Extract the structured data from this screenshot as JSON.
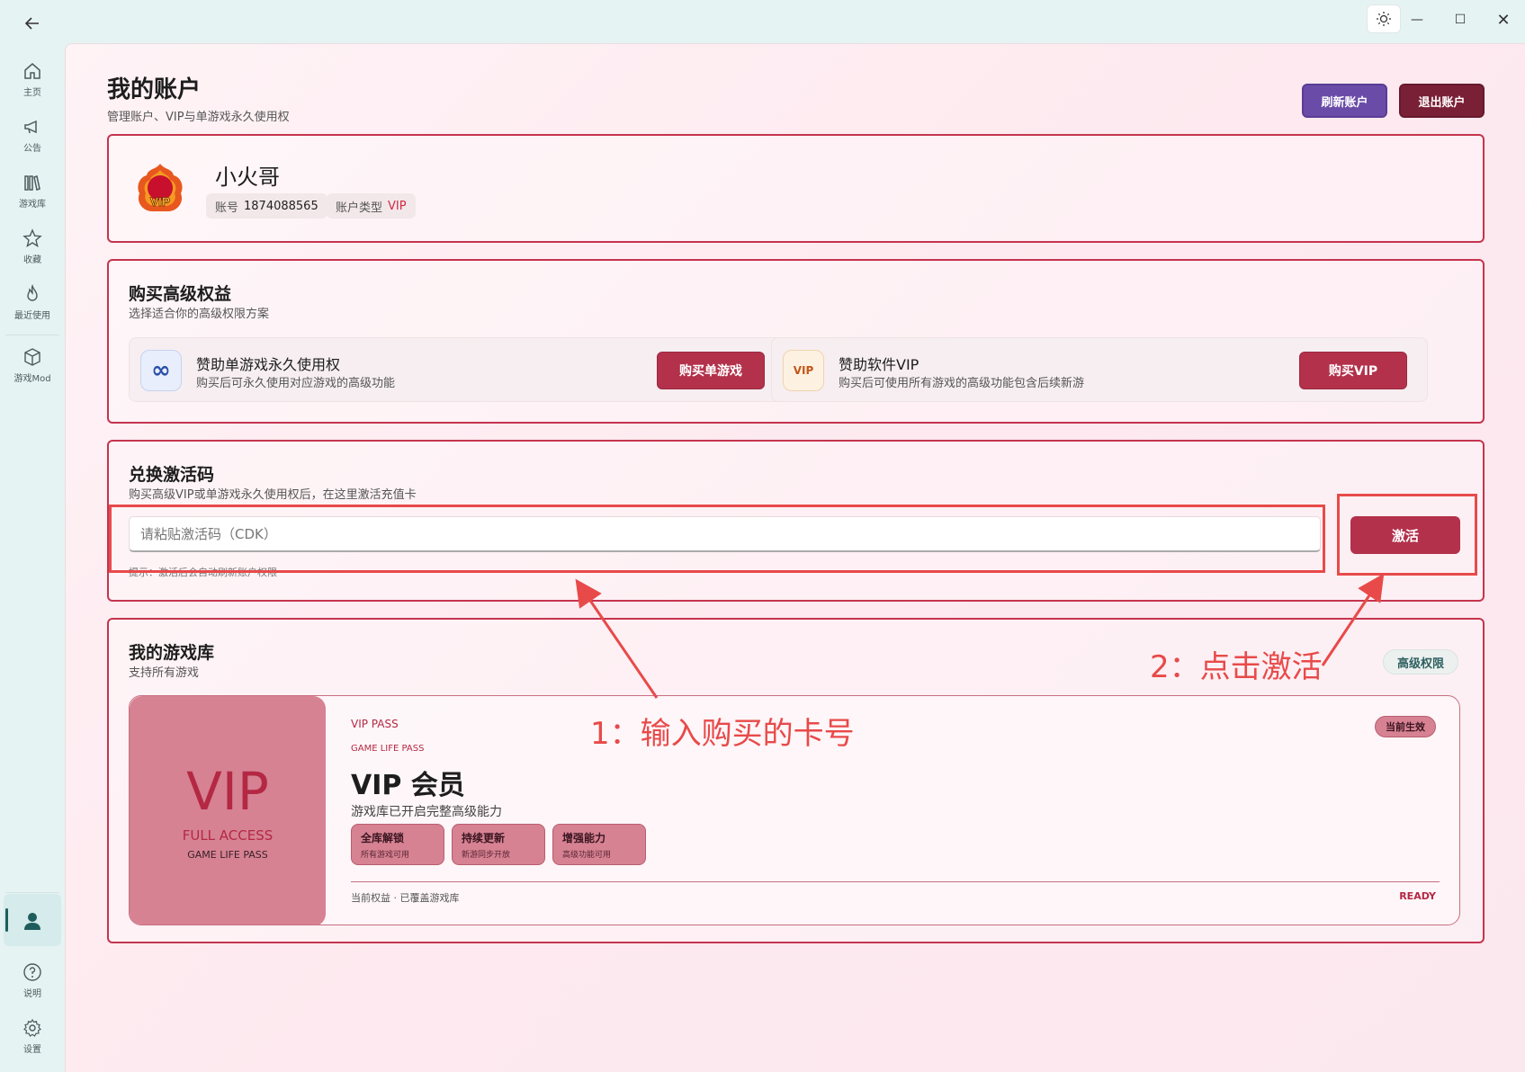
{
  "window": {
    "back_icon": "arrow-left-icon",
    "theme_icon": "sun-icon",
    "min_glyph": "—",
    "max_glyph": "☐",
    "close_glyph": "✕"
  },
  "sidebar": {
    "items": [
      {
        "label": "主页",
        "icon": "home-icon"
      },
      {
        "label": "公告",
        "icon": "megaphone-icon"
      },
      {
        "label": "游戏库",
        "icon": "library-icon"
      },
      {
        "label": "收藏",
        "icon": "star-icon"
      },
      {
        "label": "最近使用",
        "icon": "flame-icon"
      },
      {
        "label": "游戏Mod",
        "icon": "cube-icon"
      }
    ],
    "bottom": [
      {
        "label": "",
        "icon": "user-icon"
      },
      {
        "label": "说明",
        "icon": "help-icon"
      },
      {
        "label": "设置",
        "icon": "gear-icon"
      }
    ]
  },
  "header": {
    "title": "我的账户",
    "subtitle": "管理账户、VIP与单游戏永久使用权",
    "refresh_label": "刷新账户",
    "logout_label": "退出账户"
  },
  "profile": {
    "name": "小火哥",
    "account_label": "账号",
    "account_value": "1874088565",
    "type_label": "账户类型",
    "type_value": "VIP",
    "avatar_text": "VIP"
  },
  "buy": {
    "title": "购买高级权益",
    "subtitle": "选择适合你的高级权限方案",
    "options": [
      {
        "title": "赞助单游戏永久使用权",
        "desc": "购买后可永久使用对应游戏的高级功能",
        "button": "购买单游戏",
        "icon_text": "∞"
      },
      {
        "title": "赞助软件VIP",
        "desc": "购买后可使用所有游戏的高级功能包含后续新游",
        "button": "购买VIP",
        "icon_text": "VIP"
      }
    ]
  },
  "redeem": {
    "title": "兑换激活码",
    "subtitle": "购买高级VIP或单游戏永久使用权后，在这里激活充值卡",
    "placeholder": "请粘贴激活码（CDK）",
    "button": "激活",
    "hint": "提示：激活后会自动刷新账户权限"
  },
  "library": {
    "title": "我的游戏库",
    "subtitle": "支持所有游戏",
    "badge": "高级权限",
    "vip_card": {
      "art_big": "VIP",
      "art_full": "FULL ACCESS",
      "art_pass": "GAME LIFE PASS",
      "pass_label": "VIP PASS",
      "gl_label": "GAME LIFE PASS",
      "title": "VIP 会员",
      "desc": "游戏库已开启完整高级能力",
      "status": "当前生效",
      "features": [
        {
          "title": "全库解锁",
          "sub": "所有游戏可用"
        },
        {
          "title": "持续更新",
          "sub": "新游同步开放"
        },
        {
          "title": "增强能力",
          "sub": "高级功能可用"
        }
      ],
      "footer": "当前权益 · 已覆盖游戏库",
      "ready": "READY"
    }
  },
  "annotations": {
    "step1": "1：输入购买的卡号",
    "step2": "2：点击激活",
    "color": "#e84a4a"
  }
}
